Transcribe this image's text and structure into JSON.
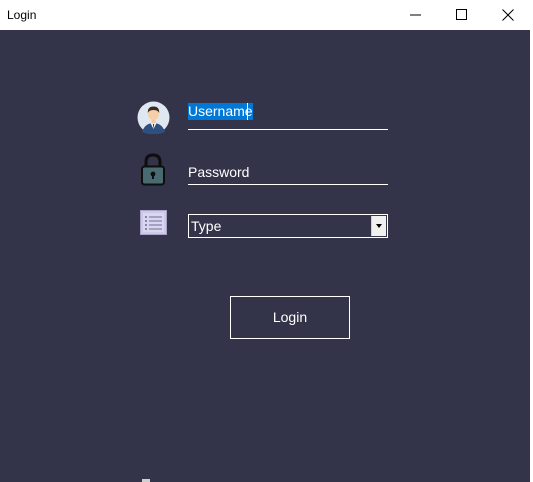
{
  "window": {
    "title": "Login",
    "controls": [
      "minimize",
      "maximize",
      "close"
    ]
  },
  "form": {
    "username": {
      "value": "Username",
      "icon": "user-avatar-icon"
    },
    "password": {
      "value": "Password",
      "icon": "padlock-icon"
    },
    "type": {
      "value": "Type",
      "icon": "list-icon"
    },
    "login_label": "Login"
  },
  "colors": {
    "background": "#33334a",
    "selection": "#0078d7",
    "text": "#ffffff"
  }
}
